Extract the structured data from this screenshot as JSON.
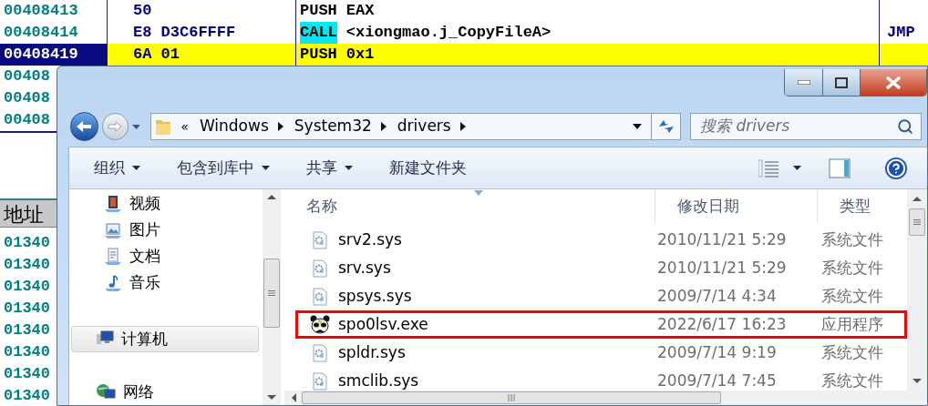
{
  "debugger": {
    "code_rows": [
      {
        "address": "00408413",
        "hex": "50",
        "mnemonic": "PUSH",
        "operands": "EAX",
        "mnemonic_highlight": false,
        "selected": false
      },
      {
        "address": "00408414",
        "hex": "E8 D3C6FFFF",
        "mnemonic": "CALL",
        "operands": "<xiongmao.j_CopyFileA>",
        "mnemonic_highlight": true,
        "comment": "JMP",
        "selected": false
      },
      {
        "address": "00408419",
        "hex": "6A 01",
        "mnemonic": "PUSH",
        "operands": "0x1",
        "mnemonic_highlight": false,
        "selected": true
      },
      {
        "address": "00408",
        "selected": false
      },
      {
        "address": "00408",
        "selected": false
      },
      {
        "address": "00408",
        "selected": false
      }
    ],
    "dump": {
      "header": "地址",
      "rows": [
        "01340",
        "01340",
        "01340",
        "01340",
        "01340",
        "01340",
        "01340",
        "01340"
      ]
    }
  },
  "explorer": {
    "breadcrumb_overflow": "«",
    "breadcrumb": [
      "Windows",
      "System32",
      "drivers"
    ],
    "search": {
      "placeholder": "搜索 drivers"
    },
    "toolbar": [
      {
        "label": "组织",
        "dropdown": true
      },
      {
        "label": "包含到库中",
        "dropdown": true
      },
      {
        "label": "共享",
        "dropdown": true
      },
      {
        "label": "新建文件夹",
        "dropdown": false
      }
    ],
    "nav": [
      {
        "label": "视频",
        "kind": "video",
        "selected": false
      },
      {
        "label": "图片",
        "kind": "picture",
        "selected": false
      },
      {
        "label": "文档",
        "kind": "document",
        "selected": false
      },
      {
        "label": "音乐",
        "kind": "music",
        "selected": false
      },
      {
        "label": "计算机",
        "kind": "computer",
        "selected": true
      },
      {
        "label": "网络",
        "kind": "network",
        "selected": false
      }
    ],
    "columns": [
      "名称",
      "修改日期",
      "类型"
    ],
    "files": [
      {
        "name": "srv2.sys",
        "date": "2010/11/21 5:29",
        "type": "系统文件",
        "kind": "sys",
        "highlighted": false
      },
      {
        "name": "srv.sys",
        "date": "2010/11/21 5:29",
        "type": "系统文件",
        "kind": "sys",
        "highlighted": false
      },
      {
        "name": "spsys.sys",
        "date": "2009/7/14 4:34",
        "type": "系统文件",
        "kind": "sys",
        "highlighted": false
      },
      {
        "name": "spo0lsv.exe",
        "date": "2022/6/17 16:23",
        "type": "应用程序",
        "kind": "exe",
        "highlighted": true
      },
      {
        "name": "spldr.sys",
        "date": "2009/7/14 9:19",
        "type": "系统文件",
        "kind": "sys",
        "highlighted": false
      },
      {
        "name": "smclib.sys",
        "date": "2009/7/14 7:45",
        "type": "系统文件",
        "kind": "sys",
        "highlighted": false
      }
    ]
  }
}
